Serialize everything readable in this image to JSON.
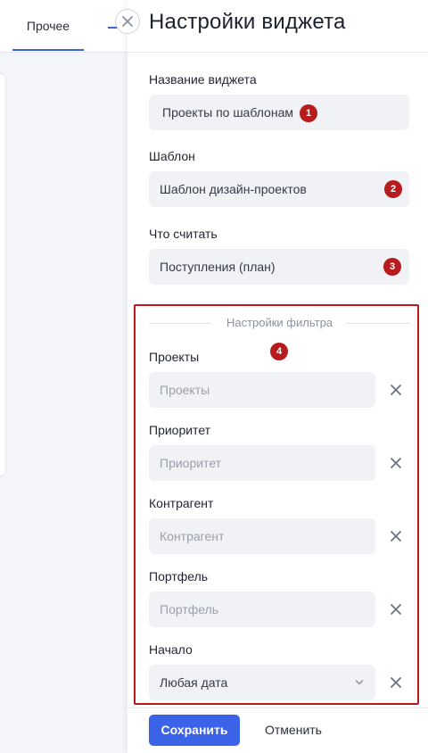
{
  "background": {
    "tab_label": "Прочее"
  },
  "panel": {
    "title": "Настройки виджета"
  },
  "fields": {
    "widget_name": {
      "label": "Название виджета",
      "value": "Проекты по шаблонам",
      "badge": "1"
    },
    "template": {
      "label": "Шаблон",
      "value": "Шаблон дизайн-проектов",
      "badge": "2"
    },
    "what_to_count": {
      "label": "Что считать",
      "value": "Поступления (план)",
      "badge": "3"
    }
  },
  "filter": {
    "title": "Настройки фильтра",
    "badge": "4",
    "projects": {
      "label": "Проекты",
      "placeholder": "Проекты"
    },
    "priority": {
      "label": "Приоритет",
      "placeholder": "Приоритет"
    },
    "counterparty": {
      "label": "Контрагент",
      "placeholder": "Контрагент"
    },
    "portfolio": {
      "label": "Портфель",
      "placeholder": "Портфель"
    },
    "start": {
      "label": "Начало",
      "value": "Любая дата"
    }
  },
  "footer": {
    "save_label": "Сохранить",
    "cancel_label": "Отменить"
  },
  "colors": {
    "accent": "#3b63e8",
    "badge": "#b71c1c",
    "field_bg": "#f1f2f6"
  },
  "icons": {
    "close": "close-icon",
    "clear": "clear-icon",
    "dropdown": "chevron-down-icon",
    "add": "plus-icon"
  }
}
